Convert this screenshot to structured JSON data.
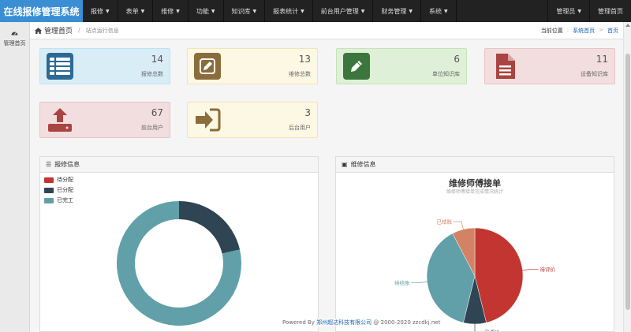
{
  "brand": "在线报修管理系统",
  "nav": {
    "items": [
      {
        "label": "报修"
      },
      {
        "label": "表单"
      },
      {
        "label": "维修"
      },
      {
        "label": "功能"
      },
      {
        "label": "知识库"
      },
      {
        "label": "报表统计"
      },
      {
        "label": "前台用户管理"
      },
      {
        "label": "财务管理"
      },
      {
        "label": "系统"
      }
    ],
    "right": {
      "admin": "管理员",
      "home": "管理首页"
    }
  },
  "sidebar": {
    "label": "管理首页"
  },
  "breadcrumb": {
    "title": "管理首页",
    "sub": "站点运行信息",
    "position_label": "当前位置",
    "system_home": "系统首页",
    "home": "首页"
  },
  "cards": [
    {
      "num": "14",
      "label": "报修总数",
      "icon": "list-icon"
    },
    {
      "num": "13",
      "label": "维修总数",
      "icon": "edit-icon"
    },
    {
      "num": "6",
      "label": "单位知识库",
      "icon": "pencil-icon"
    },
    {
      "num": "11",
      "label": "设备知识库",
      "icon": "file-icon"
    },
    {
      "num": "67",
      "label": "前台用户",
      "icon": "upload-icon"
    },
    {
      "num": "3",
      "label": "后台用户",
      "icon": "sign-in-icon"
    }
  ],
  "colors": {
    "brand": "#3a8fd4",
    "red": "#c23531",
    "dark": "#2f4554",
    "teal": "#61a0a8",
    "orange": "#d48265",
    "icon_blue": "#2c6a94",
    "icon_brown": "#8a6d3b",
    "icon_green": "#3c763d",
    "icon_red": "#a94442"
  },
  "panels": {
    "left_title": "报修信息",
    "right_title": "维修信息"
  },
  "chart_data": [
    {
      "type": "pie",
      "variant": "donut",
      "categories": [
        "待分配",
        "已分配",
        "已完工"
      ],
      "values": [
        0,
        3,
        11
      ],
      "legend": [
        "待分配",
        "已分配",
        "已完工"
      ],
      "legend_position": "top-left"
    },
    {
      "type": "pie",
      "title": "维修师傅接单",
      "subtitle": "维修师傅接单完成情况统计",
      "categories": [
        "待评价",
        "已评价",
        "待结账",
        "已结账"
      ],
      "values": [
        6,
        1,
        5,
        1
      ]
    }
  ],
  "footer": {
    "prefix": "Powered By",
    "company": "郑州超达科技有限公司",
    "suffix": "@ 2000-2020 zzcdkj.net"
  }
}
